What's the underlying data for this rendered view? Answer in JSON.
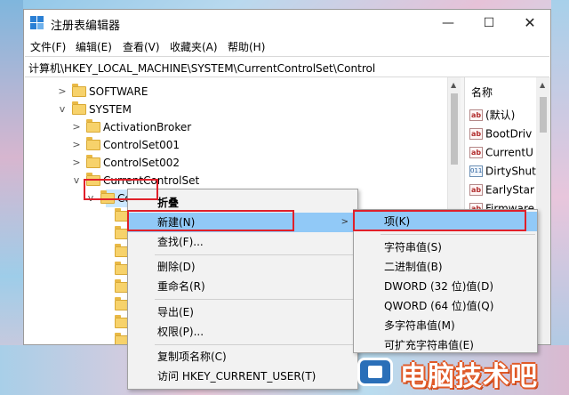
{
  "window": {
    "title": "注册表编辑器",
    "controls": {
      "minimize": "—",
      "maximize": "☐",
      "close": "✕"
    }
  },
  "menu": [
    "文件(F)",
    "编辑(E)",
    "查看(V)",
    "收藏夹(A)",
    "帮助(H)"
  ],
  "address": "计算机\\HKEY_LOCAL_MACHINE\\SYSTEM\\CurrentControlSet\\Control",
  "tree": [
    {
      "label": "SOFTWARE",
      "chevron": ">"
    },
    {
      "label": "SYSTEM",
      "chevron": "v"
    },
    {
      "label": "ActivationBroker",
      "chevron": ">"
    },
    {
      "label": "ControlSet001",
      "chevron": ">"
    },
    {
      "label": "ControlSet002",
      "chevron": ">"
    },
    {
      "label": "CurrentControlSet",
      "chevron": "v"
    },
    {
      "label": "Control",
      "chevron": "v"
    }
  ],
  "values": {
    "header": "名称",
    "items": [
      {
        "name": "(默认)",
        "type": "ab"
      },
      {
        "name": "BootDriv",
        "type": "ab"
      },
      {
        "name": "CurrentU",
        "type": "ab"
      },
      {
        "name": "DirtyShut",
        "type": "bin"
      },
      {
        "name": "EarlyStar",
        "type": "ab"
      },
      {
        "name": "Firmware",
        "type": "ab"
      }
    ]
  },
  "context_menu": {
    "items": [
      "折叠",
      "新建(N)",
      "查找(F)...",
      "删除(D)",
      "重命名(R)",
      "导出(E)",
      "权限(P)...",
      "复制项名称(C)",
      "访问 HKEY_CURRENT_USER(T)"
    ],
    "submenu_arrow": ">"
  },
  "submenu": {
    "items": [
      "项(K)",
      "字符串值(S)",
      "二进制值(B)",
      "DWORD (32 位)值(D)",
      "QWORD (64 位)值(Q)",
      "多字符串值(M)",
      "可扩充字符串值(E)"
    ]
  },
  "icons": {
    "ab": "ab",
    "bin": "011"
  },
  "colors": {
    "highlight": "#91c9f7",
    "annotation": "#e0202a",
    "folder": "#f7d26b"
  },
  "watermark": "电脑技术吧"
}
